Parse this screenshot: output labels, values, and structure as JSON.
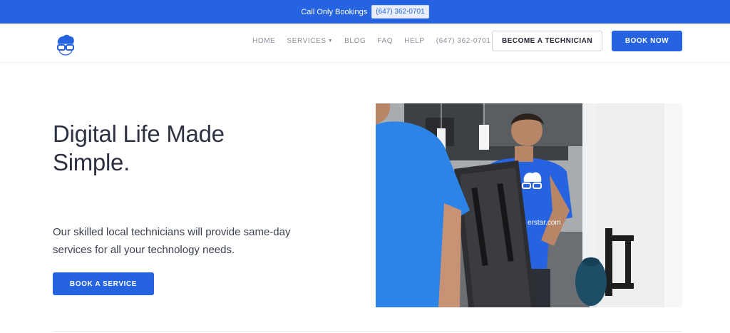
{
  "topbar": {
    "label": "Call Only Bookings",
    "phone": "(647) 362-0701"
  },
  "nav": {
    "links": [
      {
        "label": "HOME"
      },
      {
        "label": "SERVICES"
      },
      {
        "label": "BLOG"
      },
      {
        "label": "FAQ"
      },
      {
        "label": "HELP"
      },
      {
        "label": "(647) 362-0701"
      }
    ],
    "become_technician": "BECOME A TECHNICIAN",
    "book_now": "BOOK NOW"
  },
  "hero": {
    "title_line1": "Digital Life Made",
    "title_line2": "Simple.",
    "subtitle_line1": "Our skilled local technicians will provide same-day",
    "subtitle_line2": "services for all your technology needs.",
    "cta": "BOOK A SERVICE",
    "shirt_text": "erstar.com"
  },
  "colors": {
    "brand": "#2563e0",
    "text": "#2d3142",
    "nav_text": "#8a8f9a"
  },
  "icons": {
    "logo": "nerd-glasses-logo",
    "services_caret": "caret-down-icon"
  }
}
